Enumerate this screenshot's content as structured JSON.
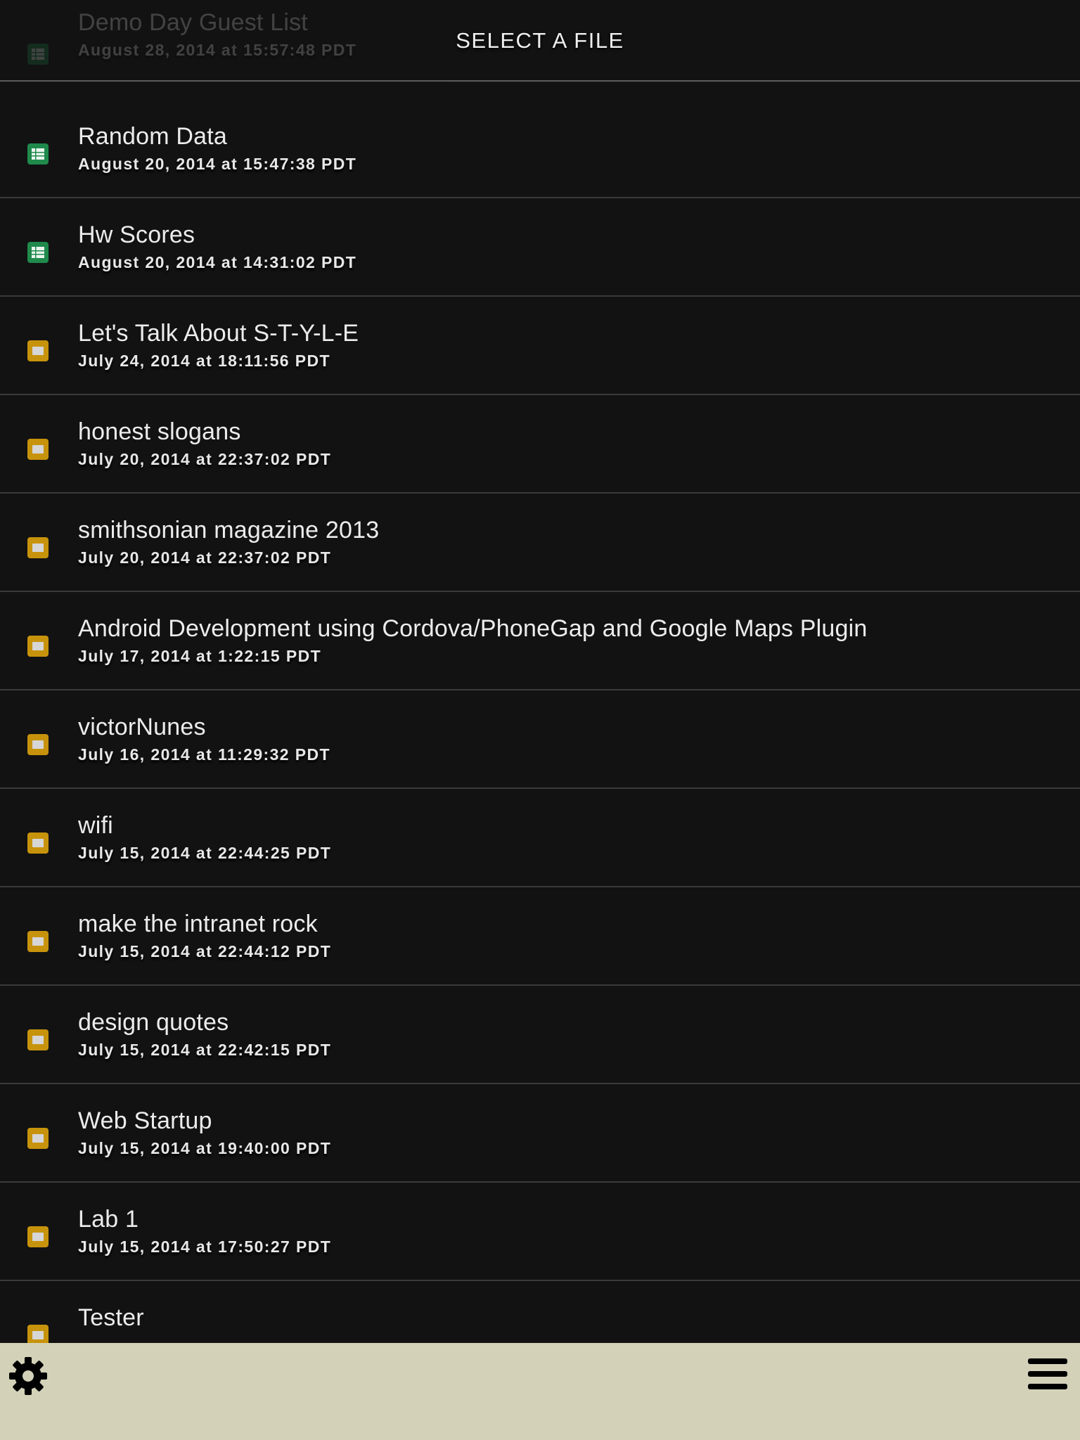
{
  "header": {
    "title": "SELECT A FILE"
  },
  "files": [
    {
      "title": "Demo Day Guest List",
      "date": "August 28, 2014 at 15:57:48 PDT",
      "icon": "spreadsheet-icon"
    },
    {
      "title": "Random Data",
      "date": "August 20, 2014 at 15:47:38 PDT",
      "icon": "spreadsheet-icon"
    },
    {
      "title": "Hw Scores",
      "date": "August 20, 2014 at 14:31:02 PDT",
      "icon": "spreadsheet-icon"
    },
    {
      "title": "Let's Talk About S-T-Y-L-E",
      "date": "July 24, 2014 at 18:11:56 PDT",
      "icon": "presentation-icon"
    },
    {
      "title": "honest slogans",
      "date": "July 20, 2014 at 22:37:02 PDT",
      "icon": "presentation-icon"
    },
    {
      "title": "smithsonian magazine 2013",
      "date": "July 20, 2014 at 22:37:02 PDT",
      "icon": "presentation-icon"
    },
    {
      "title": "Android Development using Cordova/PhoneGap and Google Maps Plugin",
      "date": "July 17, 2014 at 1:22:15 PDT",
      "icon": "presentation-icon"
    },
    {
      "title": "victorNunes",
      "date": "July 16, 2014 at 11:29:32 PDT",
      "icon": "presentation-icon"
    },
    {
      "title": "wifi",
      "date": "July 15, 2014 at 22:44:25 PDT",
      "icon": "presentation-icon"
    },
    {
      "title": "make the intranet rock",
      "date": "July 15, 2014 at 22:44:12 PDT",
      "icon": "presentation-icon"
    },
    {
      "title": "design quotes",
      "date": "July 15, 2014 at 22:42:15 PDT",
      "icon": "presentation-icon"
    },
    {
      "title": "Web Startup",
      "date": "July 15, 2014 at 19:40:00 PDT",
      "icon": "presentation-icon"
    },
    {
      "title": "Lab 1",
      "date": "July 15, 2014 at 17:50:27 PDT",
      "icon": "presentation-icon"
    },
    {
      "title": "Tester",
      "date": "",
      "icon": "presentation-icon"
    }
  ],
  "toolbar": {
    "left_icon": "gear-icon",
    "right_icon": "hamburger-menu-icon"
  },
  "colors": {
    "background": "#121212",
    "toolbar": "#d3d1b8",
    "spreadsheet": "#1f8a4c",
    "presentation": "#c8930c"
  }
}
